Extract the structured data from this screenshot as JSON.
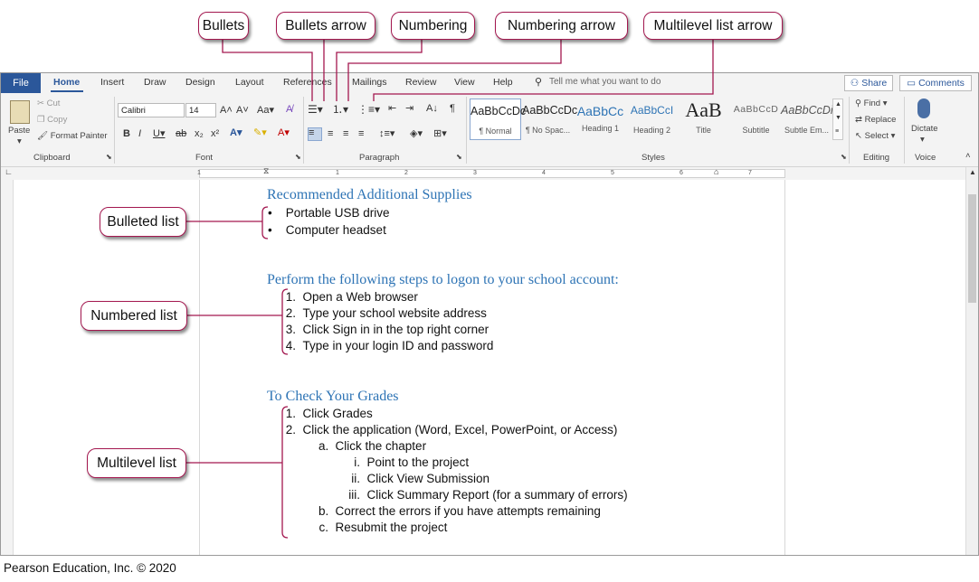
{
  "callouts": {
    "bullets": "Bullets",
    "bullets_arrow": "Bullets arrow",
    "numbering": "Numbering",
    "numbering_arrow": "Numbering arrow",
    "multilevel_arrow": "Multilevel list arrow",
    "bulleted_list": "Bulleted list",
    "numbered_list": "Numbered list",
    "multilevel_list": "Multilevel list"
  },
  "tabs": {
    "file": "File",
    "home": "Home",
    "insert": "Insert",
    "draw": "Draw",
    "design": "Design",
    "layout": "Layout",
    "references": "References",
    "mailings": "Mailings",
    "review": "Review",
    "view": "View",
    "help": "Help"
  },
  "tell_me": "Tell me what you want to do",
  "share": "Share",
  "comments": "Comments",
  "clipboard": {
    "paste": "Paste",
    "cut": "Cut",
    "copy": "Copy",
    "format_painter": "Format Painter",
    "label": "Clipboard"
  },
  "font": {
    "name": "Calibri",
    "size": "14",
    "label": "Font"
  },
  "paragraph": {
    "label": "Paragraph"
  },
  "styles": {
    "label": "Styles",
    "items": [
      {
        "sample": "AaBbCcDc",
        "name": "¶ Normal"
      },
      {
        "sample": "AaBbCcDc",
        "name": "¶ No Spac..."
      },
      {
        "sample": "AaBbCc",
        "name": "Heading 1"
      },
      {
        "sample": "AaBbCcI",
        "name": "Heading 2"
      },
      {
        "sample": "AaB",
        "name": "Title"
      },
      {
        "sample": "AaBbCcD",
        "name": "Subtitle"
      },
      {
        "sample": "AaBbCcDi",
        "name": "Subtle Em..."
      }
    ]
  },
  "editing": {
    "find": "Find",
    "replace": "Replace",
    "select": "Select",
    "label": "Editing"
  },
  "voice": {
    "dictate": "Dictate",
    "label": "Voice"
  },
  "ruler_numbers": [
    "1",
    "1",
    "2",
    "3",
    "4",
    "5",
    "6",
    "7"
  ],
  "document": {
    "heading1": "Recommended Additional Supplies",
    "bullets": [
      "Portable USB drive",
      "Computer headset"
    ],
    "heading2": "Perform the following steps to logon to your school account:",
    "steps": [
      {
        "num": "1.",
        "text": "Open a Web browser"
      },
      {
        "num": "2.",
        "text": "Type your school website address"
      },
      {
        "num": "3.",
        "text": "Click Sign in in the top right corner"
      },
      {
        "num": "4.",
        "text": "Type in your login ID and password"
      }
    ],
    "heading3": "To Check Your Grades",
    "multilevel": [
      {
        "num": "1.",
        "text": "Click Grades"
      },
      {
        "num": "2.",
        "text": "Click the application (Word, Excel, PowerPoint, or Access)"
      },
      {
        "num": "a.",
        "text": "Click the chapter"
      },
      {
        "num": "i.",
        "text": "Point to the project"
      },
      {
        "num": "ii.",
        "text": "Click View Submission"
      },
      {
        "num": "iii.",
        "text": "Click Summary Report (for a summary of errors)"
      },
      {
        "num": "b.",
        "text": "Correct the errors if you have attempts remaining"
      },
      {
        "num": "c.",
        "text": "Resubmit the project"
      }
    ]
  },
  "copyright": "Pearson Education, Inc. © 2020",
  "colors": {
    "callout_border": "#a3174f",
    "file_tab": "#2b579a",
    "heading": "#2e74b5"
  }
}
